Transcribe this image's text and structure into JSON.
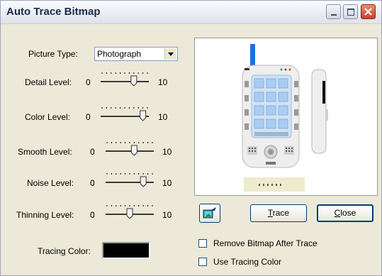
{
  "window": {
    "title": "Auto Trace Bitmap",
    "buttons": {
      "minimize": "minimize-icon",
      "maximize": "maximize-icon",
      "close": "close-icon"
    }
  },
  "picture_type": {
    "label": "Picture Type:",
    "value": "Photograph"
  },
  "sliders": [
    {
      "label": "Detail Level:",
      "min": "0",
      "max": "10",
      "value": 7
    },
    {
      "label": "Color Level:",
      "min": "0",
      "max": "10",
      "value": 9
    },
    {
      "label": "Smooth Level:",
      "min": "0",
      "max": "10",
      "value": 6
    },
    {
      "label": "Noise Level:",
      "min": "0",
      "max": "10",
      "value": 8
    },
    {
      "label": "Thinning Level:",
      "min": "0",
      "max": "10",
      "value": 5
    }
  ],
  "tracing_color": {
    "label": "Tracing Color:",
    "value": "#000000"
  },
  "buttons": {
    "trace": "Trace",
    "close": "Close",
    "icon": "trace-preview-icon"
  },
  "checkboxes": [
    {
      "label": "Remove Bitmap After Trace",
      "checked": false
    },
    {
      "label": "Use Tracing Color",
      "checked": false
    }
  ],
  "colors": {
    "dialog_bg": "#ece9d8",
    "button_border": "#003c74",
    "close_red": "#c8422a"
  }
}
